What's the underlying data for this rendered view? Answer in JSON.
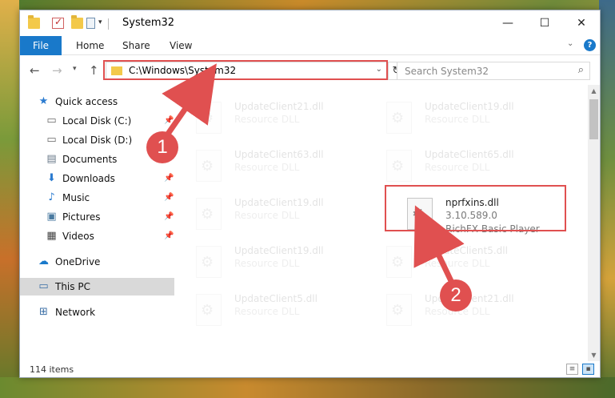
{
  "window": {
    "title": "System32"
  },
  "ribbon": {
    "tabs": [
      "File",
      "Home",
      "Share",
      "View"
    ]
  },
  "address": {
    "path": "C:\\Windows\\System32"
  },
  "search": {
    "placeholder": "Search System32"
  },
  "nav": {
    "items": [
      {
        "label": "Quick access",
        "icon": "star-icon",
        "pinned": false
      },
      {
        "label": "Local Disk (C:)",
        "icon": "drive-icon",
        "pinned": true
      },
      {
        "label": "Local Disk (D:)",
        "icon": "drive-icon",
        "pinned": false
      },
      {
        "label": "Documents",
        "icon": "documents-icon",
        "pinned": true
      },
      {
        "label": "Downloads",
        "icon": "download-icon",
        "pinned": true
      },
      {
        "label": "Music",
        "icon": "music-icon",
        "pinned": true
      },
      {
        "label": "Pictures",
        "icon": "pictures-icon",
        "pinned": true
      },
      {
        "label": "Videos",
        "icon": "videos-icon",
        "pinned": true
      },
      {
        "label": "OneDrive",
        "icon": "cloud-icon",
        "pinned": false
      },
      {
        "label": "This PC",
        "icon": "computer-icon",
        "pinned": false,
        "selected": true
      },
      {
        "label": "Network",
        "icon": "network-icon",
        "pinned": false
      }
    ]
  },
  "files": [
    {
      "name": "UpdateClient21.dll",
      "type": "Resource DLL"
    },
    {
      "name": "UpdateClient19.dll",
      "type": "Resource DLL"
    },
    {
      "name": "UpdateClient63.dll",
      "type": "Resource DLL"
    },
    {
      "name": "UpdateClient65.dll",
      "type": "Resource DLL"
    },
    {
      "name": "UpdateClient19.dll",
      "type": "Resource DLL"
    },
    {
      "name": "nprfxins.dll",
      "version": "3.10.589.0",
      "type": "RichFX Basic Player"
    },
    {
      "name": "UpdateClient19.dll",
      "type": "Resource DLL"
    },
    {
      "name": "UpdateClient5.dll",
      "type": "Resource DLL"
    },
    {
      "name": "UpdateClient5.dll",
      "type": "Resource DLL"
    },
    {
      "name": "UpdateClient21.dll",
      "type": "Resource DLL"
    }
  ],
  "status": {
    "items_count": "114 items"
  },
  "annotations": {
    "step1": "1",
    "step2": "2",
    "color": "#e05050"
  }
}
